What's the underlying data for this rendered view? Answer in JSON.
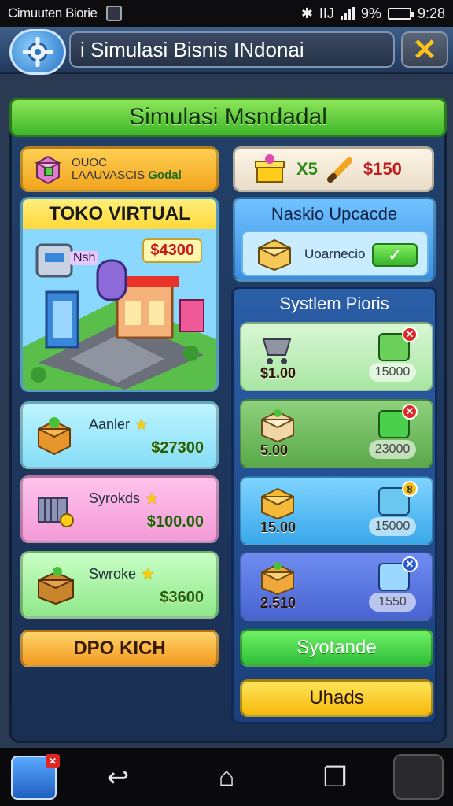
{
  "status_bar": {
    "app_name": "Cimuuten Biorie",
    "battery": "9%",
    "network": "IIJ",
    "time": "9:28"
  },
  "title_bar": {
    "title": "i Simulasi Bisnis INdonai"
  },
  "panel": {
    "header": "Simulasi Msndadal"
  },
  "pack": {
    "line1": "OUOC",
    "line2": "LAAUVASCIS",
    "good": "Godal"
  },
  "resources": {
    "multiplier": "X5",
    "cash": "$150"
  },
  "shop": {
    "title": "TOKO VIRTUAL",
    "price": "$4300",
    "tag": "Nsh"
  },
  "items": [
    {
      "name": "Aanler",
      "price": "$27300",
      "icon": "gift-box-icon"
    },
    {
      "name": "Syrokds",
      "price": "$100.00",
      "icon": "cash-register-icon"
    },
    {
      "name": "Swroke",
      "price": "$3600",
      "icon": "cardboard-box-icon"
    }
  ],
  "dpo_button": "DPO KICH",
  "upgrade": {
    "title": "Naskio Upcacde",
    "row_label": "Uoarnecio"
  },
  "system": {
    "title": "Systlem Pioris",
    "rows": [
      {
        "cost": "$1.00",
        "value": "15000",
        "badge": "✕",
        "icon": "shopping-cart-icon"
      },
      {
        "cost": "5.00",
        "value": "23000",
        "badge": "✕",
        "icon": "parcel-icon"
      },
      {
        "cost": "15.00",
        "value": "15000",
        "badge": "8",
        "icon": "crate-icon"
      },
      {
        "cost": "2.510",
        "value": "1550",
        "badge": "✕",
        "icon": "plant-box-icon"
      }
    ],
    "syst_button": "Syotande",
    "uhads_button": "Uhads"
  },
  "colors": {
    "header_green": "#3fb62a",
    "panel_blue": "#1a2f52",
    "accent_yellow": "#ffc21a",
    "price_red": "#c81818"
  }
}
